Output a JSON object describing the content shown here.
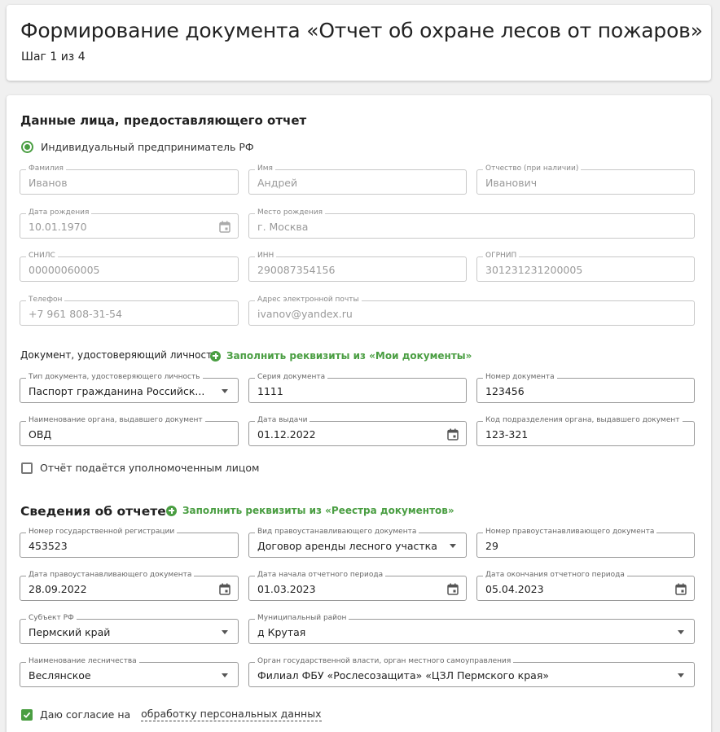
{
  "header": {
    "title": "Формирование документа «Отчет об охране лесов от пожаров»",
    "step": "Шаг 1 из 4"
  },
  "person": {
    "section_title": "Данные лица, предоставляющего отчет",
    "radio_label": "Индивидуальный предприниматель РФ",
    "fields": {
      "last_name": {
        "label": "Фамилия",
        "value": "Иванов"
      },
      "first_name": {
        "label": "Имя",
        "value": "Андрей"
      },
      "middle_name": {
        "label": "Отчество (при наличии)",
        "value": "Иванович"
      },
      "birth_date": {
        "label": "Дата рождения",
        "value": "10.01.1970"
      },
      "birth_place": {
        "label": "Место рождения",
        "value": "г. Москва"
      },
      "snils": {
        "label": "СНИЛС",
        "value": "00000060005"
      },
      "inn": {
        "label": "ИНН",
        "value": "290087354156"
      },
      "ogrnip": {
        "label": "ОГРНИП",
        "value": "301231231200005"
      },
      "phone": {
        "label": "Телефон",
        "value": "+7 961 808-31-54"
      },
      "email": {
        "label": "Адрес электронной почты",
        "value": "ivanov@yandex.ru"
      }
    }
  },
  "id_doc": {
    "title": "Документ, удостоверяющий личность",
    "fill_link": "Заполнить реквизиты из «Мои документы»",
    "fields": {
      "doc_type": {
        "label": "Тип документа, удостоверяющего личность",
        "value": "Паспорт гражданина Российск..."
      },
      "series": {
        "label": "Серия документа",
        "value": "1111"
      },
      "number": {
        "label": "Номер документа",
        "value": "123456"
      },
      "issuer": {
        "label": "Наименование органа, выдавшего документ",
        "value": "ОВД"
      },
      "issue_date": {
        "label": "Дата выдачи",
        "value": "01.12.2022"
      },
      "issuer_code": {
        "label": "Код подразделения органа, выдавшего документ",
        "value": "123-321"
      }
    },
    "proxy_checkbox": "Отчёт подаётся уполномоченным лицом"
  },
  "report": {
    "section_title": "Сведения об отчете",
    "fill_link": "Заполнить реквизиты из «Реестра документов»",
    "fields": {
      "reg_number": {
        "label": "Номер государственной регистрации",
        "value": "453523"
      },
      "doc_kind": {
        "label": "Вид правоустанавливающего документа",
        "value": "Договор аренды лесного участка"
      },
      "doc_number": {
        "label": "Номер правоустанавливающего документа",
        "value": "29"
      },
      "doc_date": {
        "label": "Дата правоустанавливающего документа",
        "value": "28.09.2022"
      },
      "period_start": {
        "label": "Дата начала отчетного периода",
        "value": "01.03.2023"
      },
      "period_end": {
        "label": "Дата окончания отчетного периода",
        "value": "05.04.2023"
      },
      "subject": {
        "label": "Субъект РФ",
        "value": "Пермский край"
      },
      "district": {
        "label": "Муниципальный район",
        "value": "д Крутая"
      },
      "forestry": {
        "label": "Наименование лесничества",
        "value": "Веслянское"
      },
      "authority": {
        "label": "Орган государственной власти, орган местного самоуправления",
        "value": "Филиал ФБУ «Рослесозащита» «ЦЗЛ Пермского края»"
      }
    }
  },
  "consent": {
    "prefix": "Даю согласие на",
    "link": "обработку персональных данных"
  },
  "colors": {
    "accent": "#4a9e42",
    "border": "#c8c8c8",
    "muted_text": "#9a9a9a"
  }
}
